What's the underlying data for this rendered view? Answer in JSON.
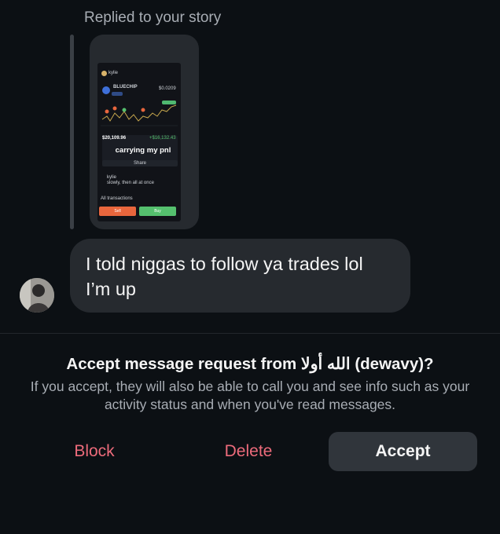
{
  "story_reply": {
    "label": "Replied to your story",
    "thumbnail": {
      "username": "kylie",
      "coin_name": "BLUECHIP",
      "price": "$0.0209",
      "pnl_value": "$20,109.96",
      "pnl_change": "+$16,132.43",
      "overlay_caption": "carrying my pnl",
      "share_label": "Share",
      "comment_user": "kylie",
      "comment_text": "slowly, then all at once",
      "transactions_label": "All transactions",
      "sell_label": "Sell",
      "buy_label": "Buy"
    }
  },
  "message": {
    "text": "I told niggas to follow ya trades lol\nI’m up"
  },
  "request": {
    "title": "Accept message request from الله أولا (dewavy)?",
    "body": "If you accept, they will also be able to call you and see info such as your activity status and when you've read messages."
  },
  "actions": {
    "block_label": "Block",
    "delete_label": "Delete",
    "accept_label": "Accept"
  },
  "colors": {
    "background": "#0c1014",
    "bubble": "#262a2f",
    "destructive": "#ed6b7b",
    "accept_button": "#30353b",
    "secondary_text": "#a8adb4"
  }
}
